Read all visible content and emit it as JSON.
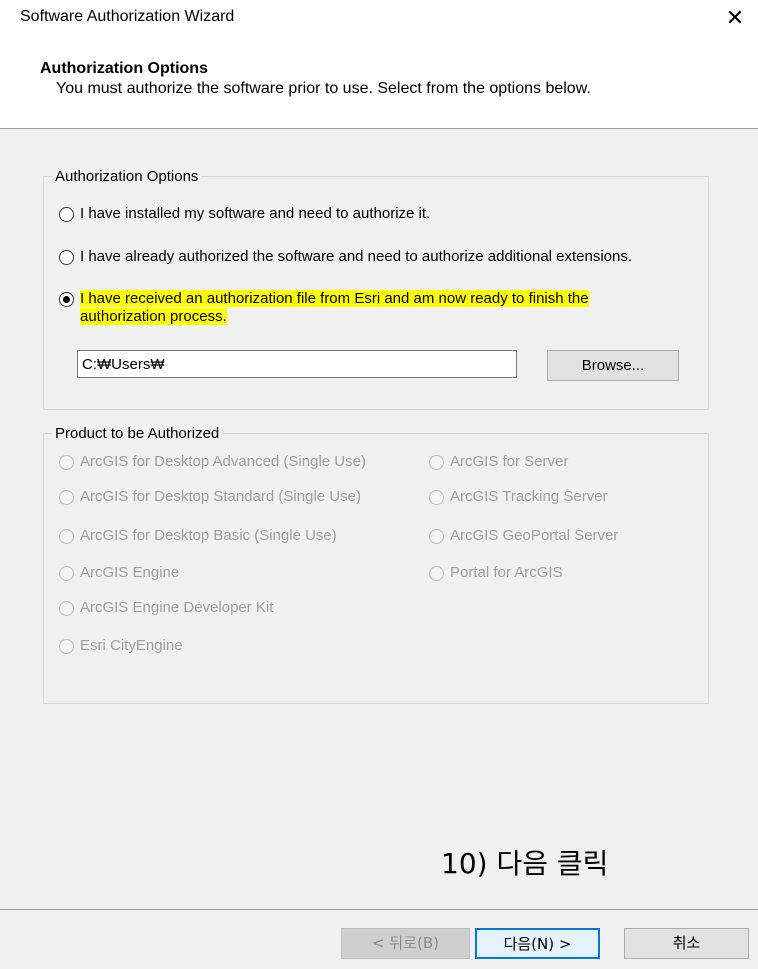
{
  "window": {
    "title": "Software Authorization Wizard",
    "close_glyph": "✕"
  },
  "header": {
    "title": "Authorization Options",
    "description": "You must authorize the software prior to use. Select from the options below."
  },
  "auth_options": {
    "legend": "Authorization Options",
    "option1": "I have installed my software and need to authorize it.",
    "option2": "I have already authorized the software and need to authorize additional extensions.",
    "option3_line1": "I have received an authorization file from Esri and am now ready to finish the",
    "option3_line2": "authorization process.",
    "selected": 3,
    "highlight_color": "#ffff00",
    "file_path": "C:₩Users₩",
    "browse_label": "Browse..."
  },
  "product": {
    "legend": "Product to be Authorized",
    "left": [
      "ArcGIS for Desktop Advanced (Single Use)",
      "ArcGIS for Desktop Standard (Single Use)",
      "ArcGIS for Desktop Basic (Single Use)",
      "ArcGIS Engine",
      "ArcGIS Engine Developer Kit",
      "Esri CityEngine"
    ],
    "right": [
      "ArcGIS for Server",
      "ArcGIS Tracking Server",
      "ArcGIS GeoPortal Server",
      "Portal for ArcGIS"
    ]
  },
  "annotation": "10) 다음 클릭",
  "footer": {
    "back": "< 뒤로(B)",
    "next": "다음(N) >",
    "cancel": "취소"
  }
}
